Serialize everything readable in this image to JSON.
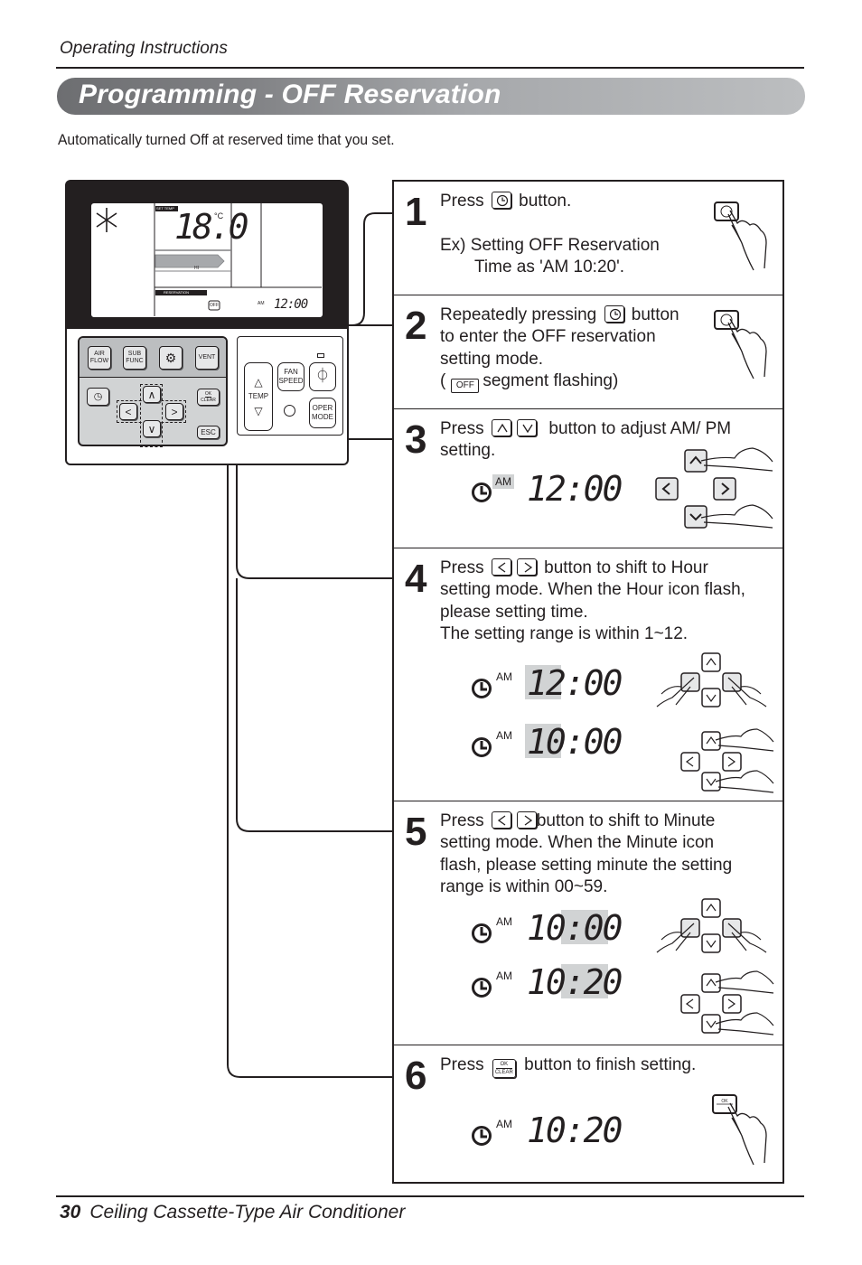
{
  "page": {
    "running_head": "Operating Instructions",
    "title": "Programming - OFF Reservation",
    "intro": "Automatically turned Off at reserved time that you set.",
    "footer": {
      "page_number": "30",
      "product": "Ceiling Cassette-Type Air Conditioner"
    },
    "colors": {
      "title_bar_dark": "#6d6e71",
      "title_bar_light": "#bcbec0",
      "highlight": "#d1d3d4",
      "ink": "#231f20"
    }
  },
  "remote": {
    "lcd": {
      "set_temp_label": "SET TEMP",
      "temperature": "18.0",
      "unit": "°C",
      "fan_label": "HI",
      "reservation_label": "RESERVATION",
      "off_segment": "OFF",
      "am": "AM",
      "time": "12:00",
      "mode_icon": "snowflake-icon"
    },
    "keypad": {
      "air_flow": "AIR FLOW",
      "sub_func": "SUB FUNC",
      "settings_icon": "gear-icon",
      "vent": "VENT",
      "timer_icon": "clock-icon",
      "ok_top": "OK",
      "ok_bottom": "CLEAR",
      "esc": "ESC",
      "up": "∧",
      "down": "∨",
      "left": "<",
      "right": ">"
    },
    "right_pad": {
      "temp": "TEMP",
      "temp_up": "△",
      "temp_down": "▽",
      "fan_speed_1": "FAN",
      "fan_speed_2": "SPEED",
      "oper_mode_1": "OPER",
      "oper_mode_2": "MODE",
      "power_icon": "power-icon"
    }
  },
  "steps": [
    {
      "number": "1",
      "text_before": "Press",
      "text_after": "button.",
      "example_line1": "Ex) Setting OFF Reservation",
      "example_line2": "Time as 'AM 10:20'."
    },
    {
      "number": "2",
      "line1_before": "Repeatedly pressing",
      "line1_after": "button",
      "line2": "to enter the OFF reservation",
      "line3": "setting mode.",
      "line4_before": "(",
      "off_label": "OFF",
      "line4_after": "segment flashing)"
    },
    {
      "number": "3",
      "text_before": "Press",
      "text_after": "button to adjust AM/ PM",
      "line2": "setting.",
      "display": {
        "am": "AM",
        "time": "12:00",
        "highlight": "AM"
      }
    },
    {
      "number": "4",
      "text_before": "Press",
      "text_after": "button to shift to Hour",
      "line2": "setting mode. When the Hour icon flash,",
      "line3": "please setting time.",
      "line4": "The setting range is within 1~12.",
      "displays": [
        {
          "am": "AM",
          "hour": "12",
          "minute": "00",
          "highlight": "hour"
        },
        {
          "am": "AM",
          "hour": "10",
          "minute": "00",
          "highlight": "hour"
        }
      ]
    },
    {
      "number": "5",
      "text_before": "Press",
      "text_after": "button to shift to Minute",
      "line2": "setting mode. When the Minute icon",
      "line3": "flash, please setting minute the setting",
      "line4": "range is within 00~59.",
      "displays": [
        {
          "am": "AM",
          "hour": "10",
          "minute": "00",
          "highlight": "minute"
        },
        {
          "am": "AM",
          "hour": "10",
          "minute": "20",
          "highlight": "minute"
        }
      ]
    },
    {
      "number": "6",
      "text_before": "Press",
      "ok_top": "OK",
      "ok_bottom": "CLEAR",
      "text_after": "button to finish setting.",
      "display": {
        "am": "AM",
        "time": "10:20"
      }
    }
  ]
}
